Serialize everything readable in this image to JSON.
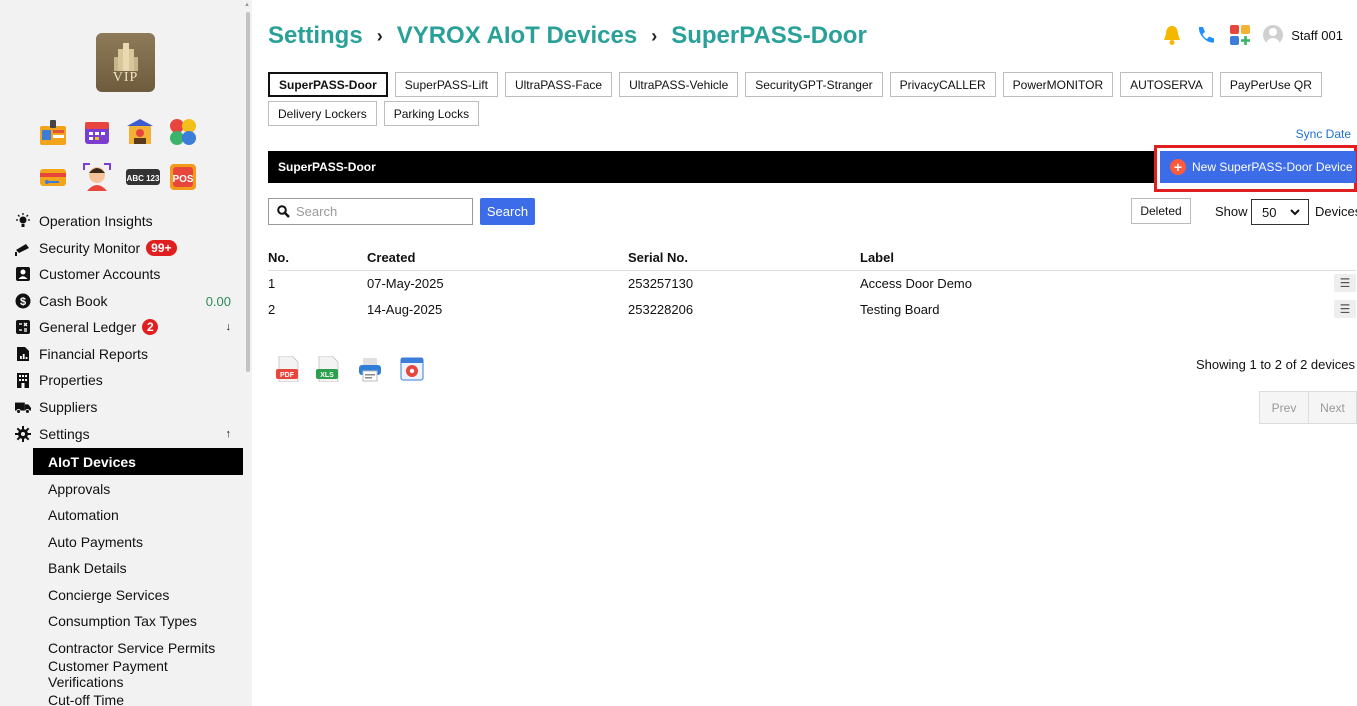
{
  "breadcrumb": [
    "Settings",
    "VYROX AIoT Devices",
    "SuperPASS-Door"
  ],
  "topbar": {
    "user_name": "Staff 001",
    "icons": [
      "bell-icon",
      "phone-icon",
      "apps-grid-icon",
      "user-avatar"
    ]
  },
  "logo": {
    "text": "VIP"
  },
  "app_icons": [
    "id-card-app",
    "calendar-app",
    "building-app",
    "puzzle-app",
    "keycard-app",
    "face-recognition-app",
    "license-plate-app",
    "pos-app"
  ],
  "app_icon_labels": {
    "license_plate": "ABC 123",
    "pos": "POS"
  },
  "sidebar": {
    "items": [
      {
        "label": "Operation Insights",
        "icon": "bulb-icon"
      },
      {
        "label": "Security Monitor",
        "icon": "cctv-icon",
        "badge": "99+"
      },
      {
        "label": "Customer Accounts",
        "icon": "account-icon"
      },
      {
        "label": "Cash Book",
        "icon": "dollar-icon",
        "right": "0.00"
      },
      {
        "label": "General Ledger",
        "icon": "ledger-icon",
        "badge": "2",
        "right": "↓"
      },
      {
        "label": "Financial Reports",
        "icon": "report-icon"
      },
      {
        "label": "Properties",
        "icon": "building-icon"
      },
      {
        "label": "Suppliers",
        "icon": "truck-icon"
      },
      {
        "label": "Settings",
        "icon": "gear-icon",
        "right": "↑"
      }
    ],
    "settings_sub": [
      "AIoT Devices",
      "Approvals",
      "Automation",
      "Auto Payments",
      "Bank Details",
      "Concierge Services",
      "Consumption Tax Types",
      "Contractor Service Permits",
      "Customer Payment Verifications",
      "Cut-off Time"
    ],
    "active_sub": "AIoT Devices"
  },
  "tabs_row1": [
    "SuperPASS-Door",
    "SuperPASS-Lift",
    "UltraPASS-Face",
    "UltraPASS-Vehicle",
    "SecurityGPT-Stranger",
    "PrivacyCALLER",
    "PowerMONITOR",
    "AUTOSERVA",
    "PayPerUse QR"
  ],
  "tabs_row2": [
    "Delivery Lockers",
    "Parking Locks"
  ],
  "active_tab": "SuperPASS-Door",
  "sync_date": "Sync Date",
  "section_title": "SuperPASS-Door",
  "new_device_button": "New SuperPASS-Door Device",
  "search": {
    "placeholder": "Search",
    "button": "Search"
  },
  "deleted_button": "Deleted",
  "show": {
    "label": "Show",
    "value": "50",
    "suffix": "Devices"
  },
  "table": {
    "columns": [
      "No.",
      "Created",
      "Serial No.",
      "Label"
    ],
    "rows": [
      {
        "no": "1",
        "created": "07-May-2025",
        "serial": "253257130",
        "label": "Access Door Demo"
      },
      {
        "no": "2",
        "created": "14-Aug-2025",
        "serial": "253228206",
        "label": "Testing Board"
      }
    ]
  },
  "export_icons": [
    "pdf-icon",
    "xls-icon",
    "print-icon",
    "settings-window-icon"
  ],
  "export_labels": {
    "pdf": "PDF",
    "xls": "XLS"
  },
  "showing_text": "Showing 1 to 2 of 2 devices",
  "pager": {
    "prev": "Prev",
    "next": "Next"
  }
}
